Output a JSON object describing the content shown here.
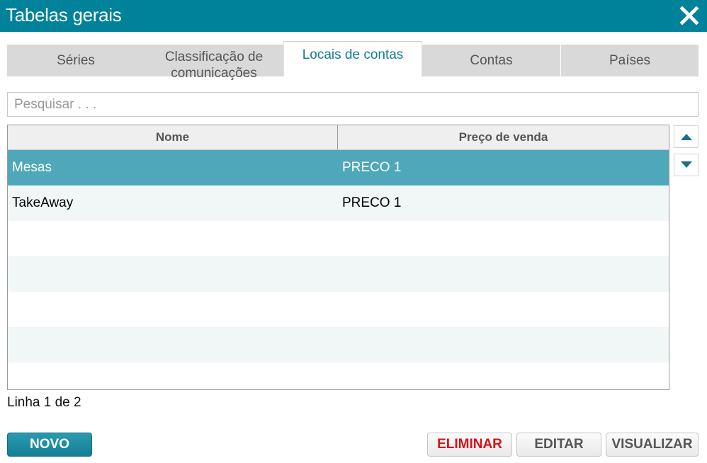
{
  "window": {
    "title": "Tabelas gerais"
  },
  "tabs": [
    {
      "label": "Séries",
      "active": false
    },
    {
      "label": "Classificação de comunicações",
      "active": false
    },
    {
      "label": "Locais de contas",
      "active": true
    },
    {
      "label": "Contas",
      "active": false
    },
    {
      "label": "Países",
      "active": false
    }
  ],
  "search": {
    "placeholder": "Pesquisar . . ."
  },
  "table": {
    "columns": [
      "Nome",
      "Preço de venda"
    ],
    "rows": [
      {
        "nome": "Mesas",
        "preco": "PRECO 1",
        "selected": true
      },
      {
        "nome": "TakeAway",
        "preco": "PRECO 1",
        "selected": false
      },
      {
        "nome": "",
        "preco": ""
      },
      {
        "nome": "",
        "preco": ""
      },
      {
        "nome": "",
        "preco": ""
      },
      {
        "nome": "",
        "preco": ""
      },
      {
        "nome": "",
        "preco": ""
      }
    ]
  },
  "status": {
    "row_counter": "Linha 1 de 2"
  },
  "buttons": {
    "novo": "NOVO",
    "eliminar": "ELIMINAR",
    "editar": "EDITAR",
    "visualizar": "VISUALIZAR"
  },
  "colors": {
    "accent": "#00829a",
    "selected_row": "#4fa8ba",
    "danger": "#d0141b"
  },
  "icons": {
    "close": "close-icon",
    "up": "arrow-up-icon",
    "down": "arrow-down-icon"
  }
}
